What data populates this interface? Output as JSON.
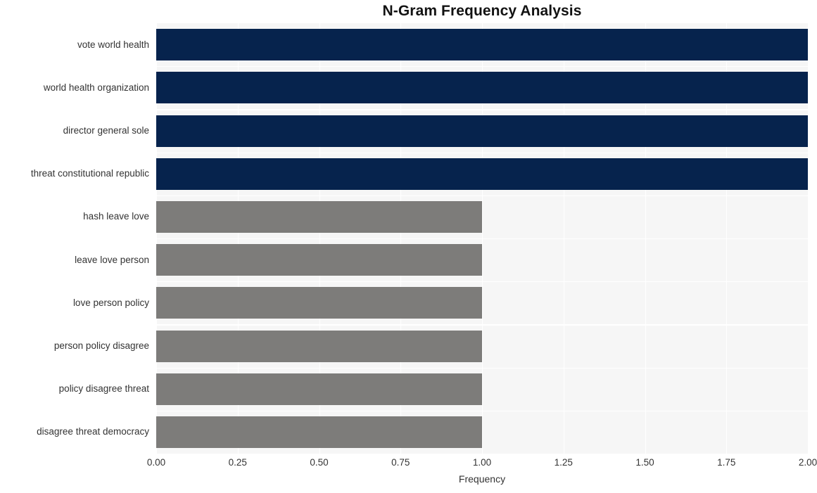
{
  "chart_data": {
    "type": "bar",
    "orientation": "horizontal",
    "title": "N-Gram Frequency Analysis",
    "xlabel": "Frequency",
    "ylabel": "",
    "xlim": [
      0.0,
      2.0
    ],
    "xticks": [
      "0.00",
      "0.25",
      "0.50",
      "0.75",
      "1.00",
      "1.25",
      "1.50",
      "1.75",
      "2.00"
    ],
    "xtick_values": [
      0.0,
      0.25,
      0.5,
      0.75,
      1.0,
      1.25,
      1.5,
      1.75,
      2.0
    ],
    "grid": true,
    "legend": "none",
    "categories": [
      "vote world health",
      "world health organization",
      "director general sole",
      "threat constitutional republic",
      "hash leave love",
      "leave love person",
      "love person policy",
      "person policy disagree",
      "policy disagree threat",
      "disagree threat democracy"
    ],
    "values": [
      2,
      2,
      2,
      2,
      1,
      1,
      1,
      1,
      1,
      1
    ],
    "bar_colors": [
      "#06234d",
      "#06234d",
      "#06234d",
      "#06234d",
      "#7d7c7a",
      "#7d7c7a",
      "#7d7c7a",
      "#7d7c7a",
      "#7d7c7a",
      "#7d7c7a"
    ],
    "colors": {
      "highlight": "#06234d",
      "normal": "#7d7c7a",
      "plot_background": "#f6f6f6",
      "figure_background": "#ffffff",
      "gridline": "#ffffff",
      "text": "#333333",
      "title": "#121212"
    }
  }
}
